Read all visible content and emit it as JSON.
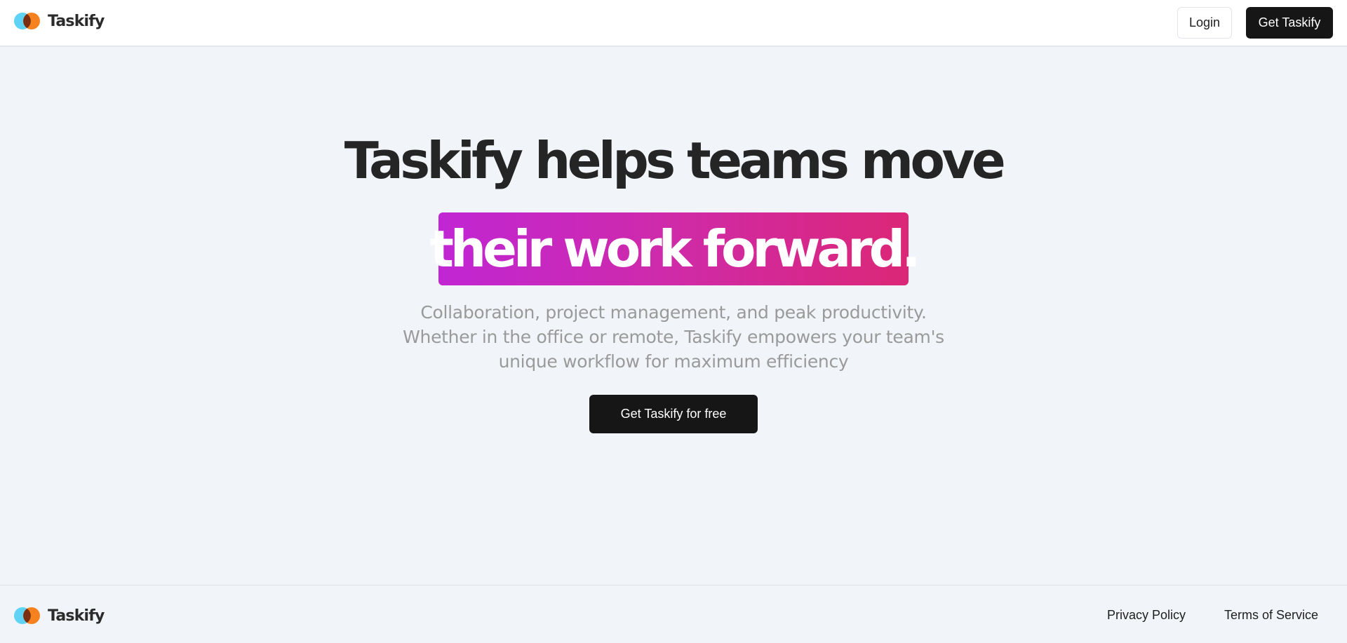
{
  "header": {
    "brand": "Taskify",
    "login_label": "Login",
    "get_label": "Get Taskify"
  },
  "hero": {
    "title_line1": "Taskify helps teams move",
    "title_highlight": "their work forward.",
    "subtitle_lines": [
      "Collaboration, project management, and peak productivity.",
      "Whether in the office or remote, Taskify empowers your team's",
      "unique workflow for maximum efficiency"
    ],
    "cta_label": "Get Taskify for free"
  },
  "footer": {
    "brand": "Taskify",
    "links": [
      "Privacy Policy",
      "Terms of Service"
    ]
  },
  "colors": {
    "background": "#f1f4f8",
    "dark_button": "#161616",
    "highlight_start": "#c026d3",
    "highlight_end": "#db2777",
    "logo_blue": "#5fd3f5",
    "logo_orange": "#f5821f"
  },
  "icons": {
    "logo": "taskify-logo-icon"
  }
}
